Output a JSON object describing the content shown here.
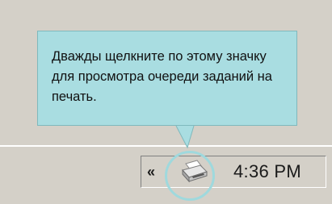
{
  "tooltip": {
    "text": "Дважды щелкните по этому значку для просмотра очереди заданий на печать."
  },
  "taskbar": {
    "expand_glyph": "«",
    "tray_icons": [
      "printer-icon"
    ],
    "clock": "4:36 PM"
  },
  "colors": {
    "tooltip_background": "#a9dde1",
    "highlight_ring": "#9fd9dd",
    "window_gray": "#d4d0c8"
  }
}
